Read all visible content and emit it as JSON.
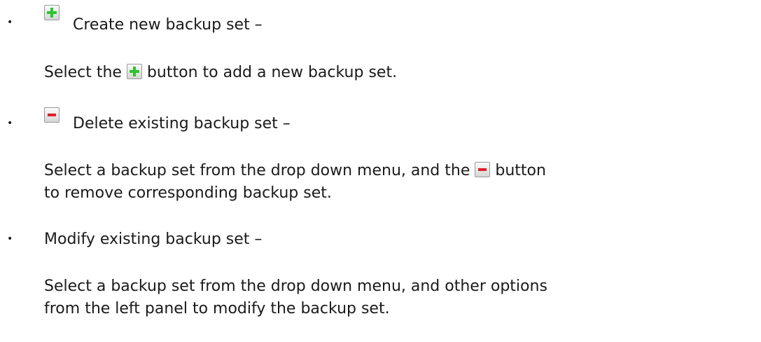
{
  "items": [
    {
      "bullet": "•",
      "icon": "plus-icon",
      "heading": "Create new backup set –",
      "desc_before": "Select the",
      "desc_icon": "plus-icon",
      "desc_after": "button to add a new backup set."
    },
    {
      "bullet": "•",
      "icon": "minus-icon",
      "heading": "Delete existing backup set –",
      "desc_line1_before": "Select a backup set from the drop down menu, and the",
      "desc_icon": "minus-icon",
      "desc_line1_after": "button",
      "desc_line2": "to remove corresponding backup set."
    },
    {
      "bullet": "•",
      "heading": "Modify existing backup set –",
      "desc_line1": "Select a backup set from the drop down menu, and other options",
      "desc_line2": "from the left panel to modify the backup set."
    }
  ],
  "colors": {
    "plus_icon": "#2ec42e",
    "minus_icon": "#e0202a",
    "text": "#1a1a1a"
  }
}
